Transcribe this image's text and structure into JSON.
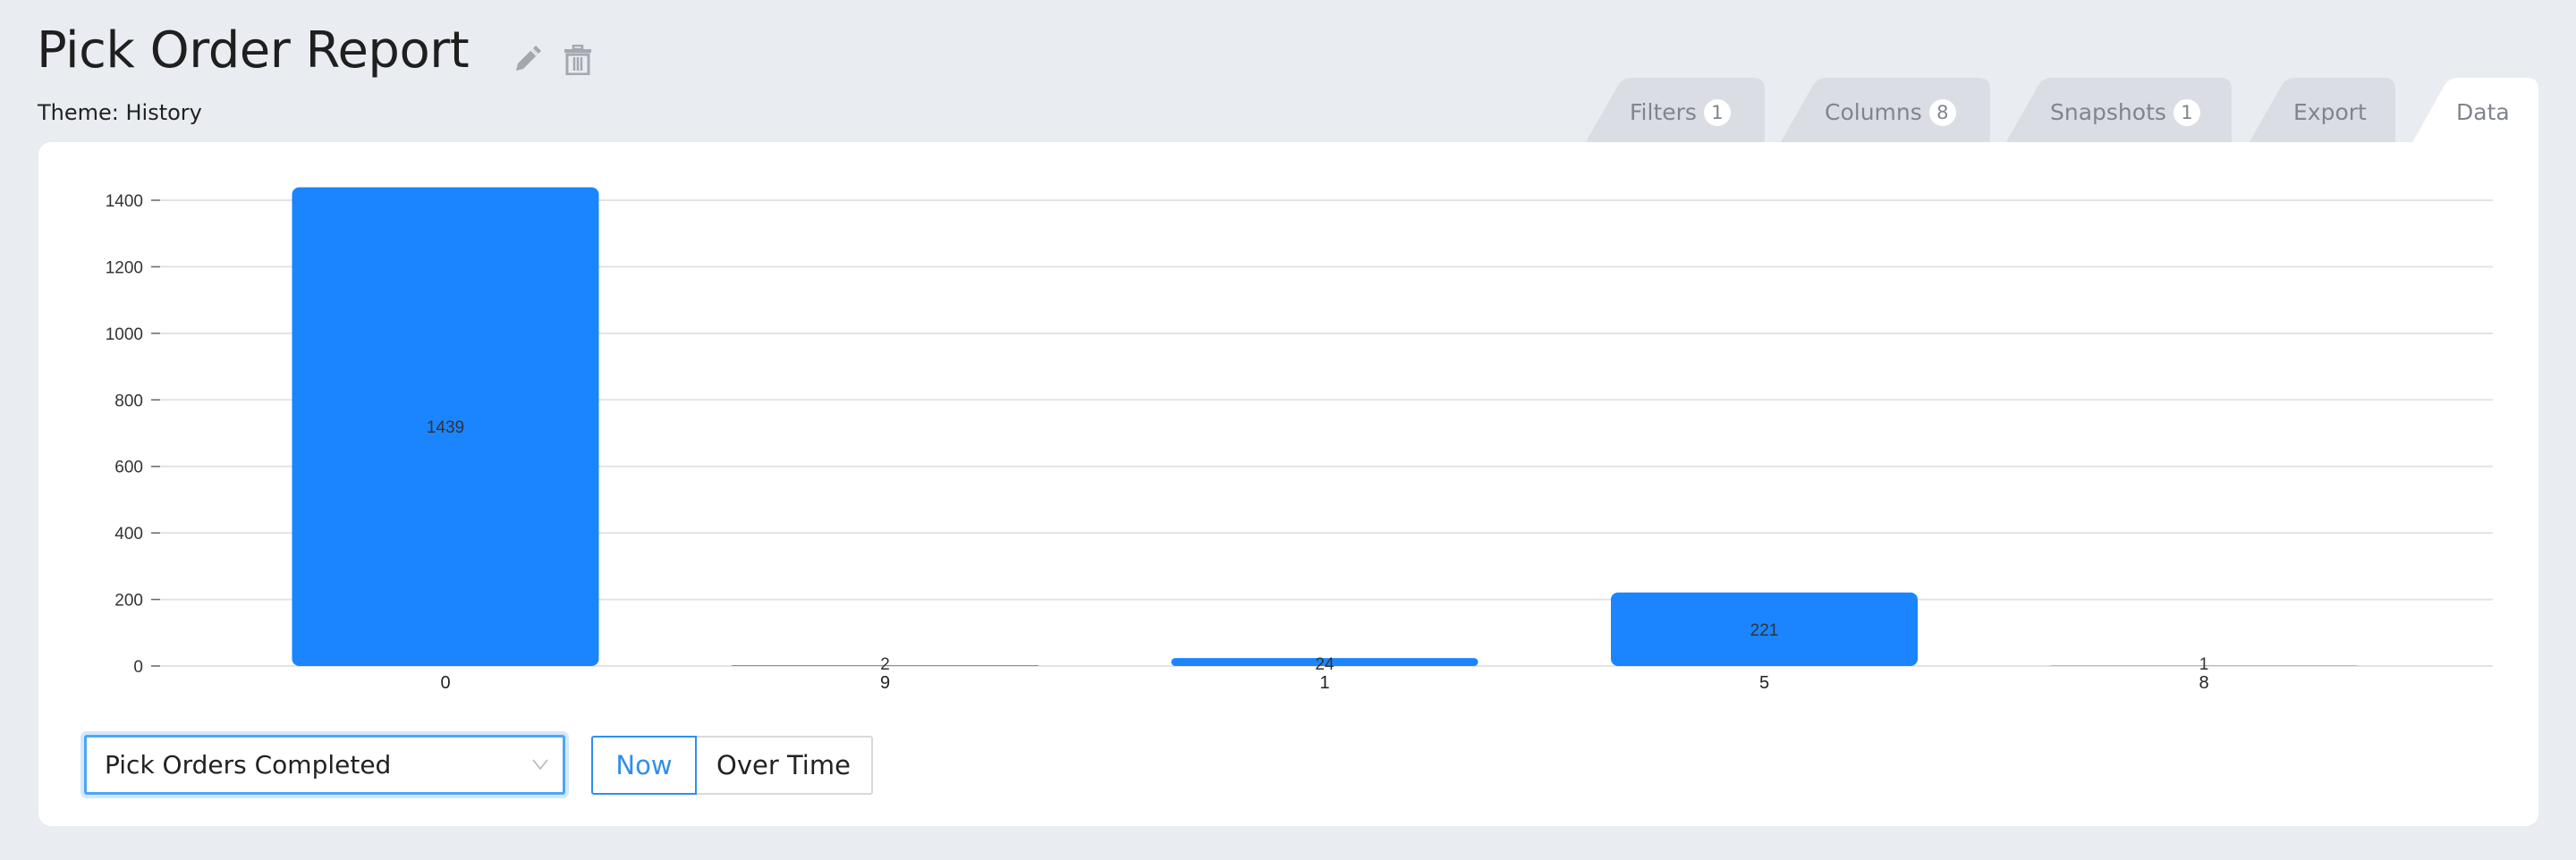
{
  "header": {
    "title": "Pick Order Report",
    "theme_label": "Theme: History",
    "edit_icon": "pencil-icon",
    "delete_icon": "trash-icon"
  },
  "tabs": [
    {
      "label": "Filters",
      "badge": "1",
      "active": false
    },
    {
      "label": "Columns",
      "badge": "8",
      "active": false
    },
    {
      "label": "Snapshots",
      "badge": "1",
      "active": false
    },
    {
      "label": "Export",
      "badge": null,
      "active": false
    },
    {
      "label": "Data",
      "badge": null,
      "active": true
    }
  ],
  "controls": {
    "metric_select": "Pick Orders Completed",
    "mode_buttons": [
      {
        "label": "Now",
        "selected": true
      },
      {
        "label": "Over Time",
        "selected": false
      }
    ]
  },
  "colors": {
    "bar": "#1A85FF",
    "accent": "#2F8FEA",
    "background": "#E9ECF1",
    "tab_inactive": "#DADDE3"
  },
  "chart_data": {
    "type": "bar",
    "title": "",
    "xlabel": "",
    "ylabel": "",
    "categories": [
      "0",
      "9",
      "1",
      "5",
      "8"
    ],
    "values": [
      1439,
      2,
      24,
      221,
      1
    ],
    "data_labels": [
      "1439",
      "2",
      "24",
      "221",
      "1"
    ],
    "ylim": [
      0,
      1400
    ],
    "yticks": [
      0,
      200,
      400,
      600,
      800,
      1000,
      1200,
      1400
    ],
    "grid": true,
    "legend": "none"
  }
}
